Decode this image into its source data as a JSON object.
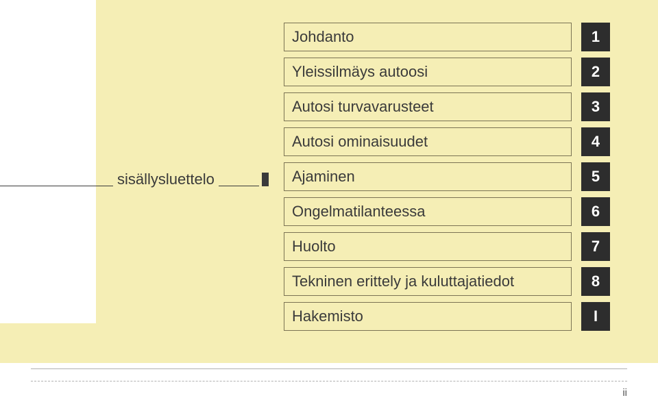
{
  "toc_label": "sisällysluettelo",
  "items": [
    {
      "title": "Johdanto",
      "num": "1"
    },
    {
      "title": "Yleissilmäys autoosi",
      "num": "2"
    },
    {
      "title": "Autosi turvavarusteet",
      "num": "3"
    },
    {
      "title": "Autosi ominaisuudet",
      "num": "4"
    },
    {
      "title": "Ajaminen",
      "num": "5"
    },
    {
      "title": "Ongelmatilanteessa",
      "num": "6"
    },
    {
      "title": "Huolto",
      "num": "7"
    },
    {
      "title": "Tekninen erittely ja kuluttajatiedot",
      "num": "8"
    },
    {
      "title": "Hakemisto",
      "num": "I"
    }
  ],
  "page_number": "ii"
}
